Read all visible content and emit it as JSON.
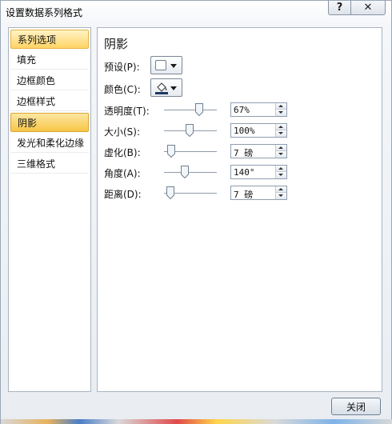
{
  "window": {
    "title": "设置数据系列格式",
    "help_label": "?",
    "close_label": "✕"
  },
  "sidebar": {
    "items": [
      {
        "label": "系列选项"
      },
      {
        "label": "填充"
      },
      {
        "label": "边框颜色"
      },
      {
        "label": "边框样式"
      },
      {
        "label": "阴影"
      },
      {
        "label": "发光和柔化边缘"
      },
      {
        "label": "三维格式"
      }
    ],
    "selected_index": 4
  },
  "panel": {
    "title": "阴影",
    "preset_label": "预设(P):",
    "color_label": "颜色(C):",
    "sliders": [
      {
        "label": "透明度(T):",
        "value": "67%",
        "fraction": 0.67
      },
      {
        "label": "大小(S):",
        "value": "100%",
        "fraction": 0.48
      },
      {
        "label": "虚化(B):",
        "value": "7 磅",
        "fraction": 0.14
      },
      {
        "label": "角度(A):",
        "value": "140°",
        "fraction": 0.39
      },
      {
        "label": "距离(D):",
        "value": "7 磅",
        "fraction": 0.12
      }
    ]
  },
  "footer": {
    "close_button_label": "关闭"
  },
  "colors": {
    "selection": "#ffd466",
    "border": "#a9b4c1",
    "accent_dark": "#1f3864"
  },
  "icons": {
    "preset": "shadow-preset-swatch-icon",
    "color": "paint-bucket-icon"
  }
}
